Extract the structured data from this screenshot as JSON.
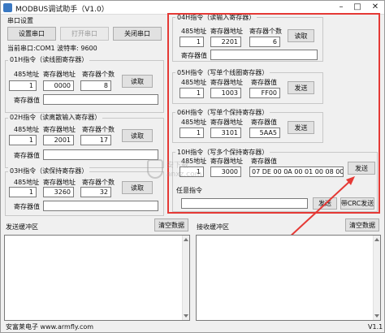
{
  "window": {
    "title": "MODBUS调试助手（V1.0）",
    "controls": {
      "minimize": "–",
      "maximize": "□",
      "close": "✕"
    }
  },
  "serial": {
    "group_label": "串口设置",
    "setup_button": "设置串口",
    "open_button": "打开串口",
    "close_button": "关闭串口",
    "status_text": "当前串口:COM1 波特率: 9600"
  },
  "cmd01": {
    "title": "01H指令（读线圈寄存器）",
    "col_addr": "485地址",
    "col_reg": "寄存器地址",
    "col_count": "寄存器个数",
    "addr": "1",
    "reg": "0000",
    "count": "8",
    "button": "读取",
    "value_label": "寄存器值",
    "value": ""
  },
  "cmd02": {
    "title": "02H指令（读离散输入寄存器）",
    "col_addr": "485地址",
    "col_reg": "寄存器地址",
    "col_count": "寄存器个数",
    "addr": "1",
    "reg": "2001",
    "count": "17",
    "button": "读取",
    "value_label": "寄存器值",
    "value": ""
  },
  "cmd03": {
    "title": "03H指令（读保持寄存器）",
    "col_addr": "485地址",
    "col_reg": "寄存器地址",
    "col_count": "寄存器个数",
    "addr": "1",
    "reg": "3260",
    "count": "32",
    "button": "读取",
    "value_label": "寄存器值",
    "value": ""
  },
  "cmd04": {
    "title": "04H指令（读输入寄存器）",
    "col_addr": "485地址",
    "col_reg": "寄存器地址",
    "col_count": "寄存器个数",
    "addr": "1",
    "reg": "2201",
    "count": "6",
    "button": "读取",
    "value_label": "寄存器值",
    "value": ""
  },
  "cmd05": {
    "title": "05H指令（写单个线圈寄存器）",
    "col_addr": "485地址",
    "col_reg": "寄存器地址",
    "col_value": "寄存器值",
    "addr": "1",
    "reg": "1003",
    "value": "FF00",
    "button": "发送"
  },
  "cmd06": {
    "title": "06H指令（写单个保持寄存器）",
    "col_addr": "485地址",
    "col_reg": "寄存器地址",
    "col_value": "寄存器值",
    "addr": "1",
    "reg": "3101",
    "value": "5AA5",
    "button": "发送"
  },
  "cmd10": {
    "title": "10H指令（写多个保持寄存器）",
    "col_addr": "485地址",
    "col_reg": "寄存器地址",
    "col_value": "寄存器值",
    "addr": "1",
    "reg": "3000",
    "value": "07 DE 00 0A 00 01 00 08 00 0C 00",
    "button": "发送"
  },
  "arbitrary": {
    "label": "任意指令",
    "value": "",
    "send_button": "发送",
    "crc_button": "带CRC发送"
  },
  "send_buffer": {
    "label": "发送缓冲区",
    "clear_button": "清空数据"
  },
  "recv_buffer": {
    "label": "接收缓冲区",
    "clear_button": "清空数据"
  },
  "watermark": {
    "line1": "安下载",
    "line2": "anxz.com"
  },
  "status": {
    "left": "安富莱电子  www.armfly.com",
    "version": "V1.1"
  },
  "colors": {
    "highlight": "#e53935",
    "arrow": "#e53935"
  }
}
